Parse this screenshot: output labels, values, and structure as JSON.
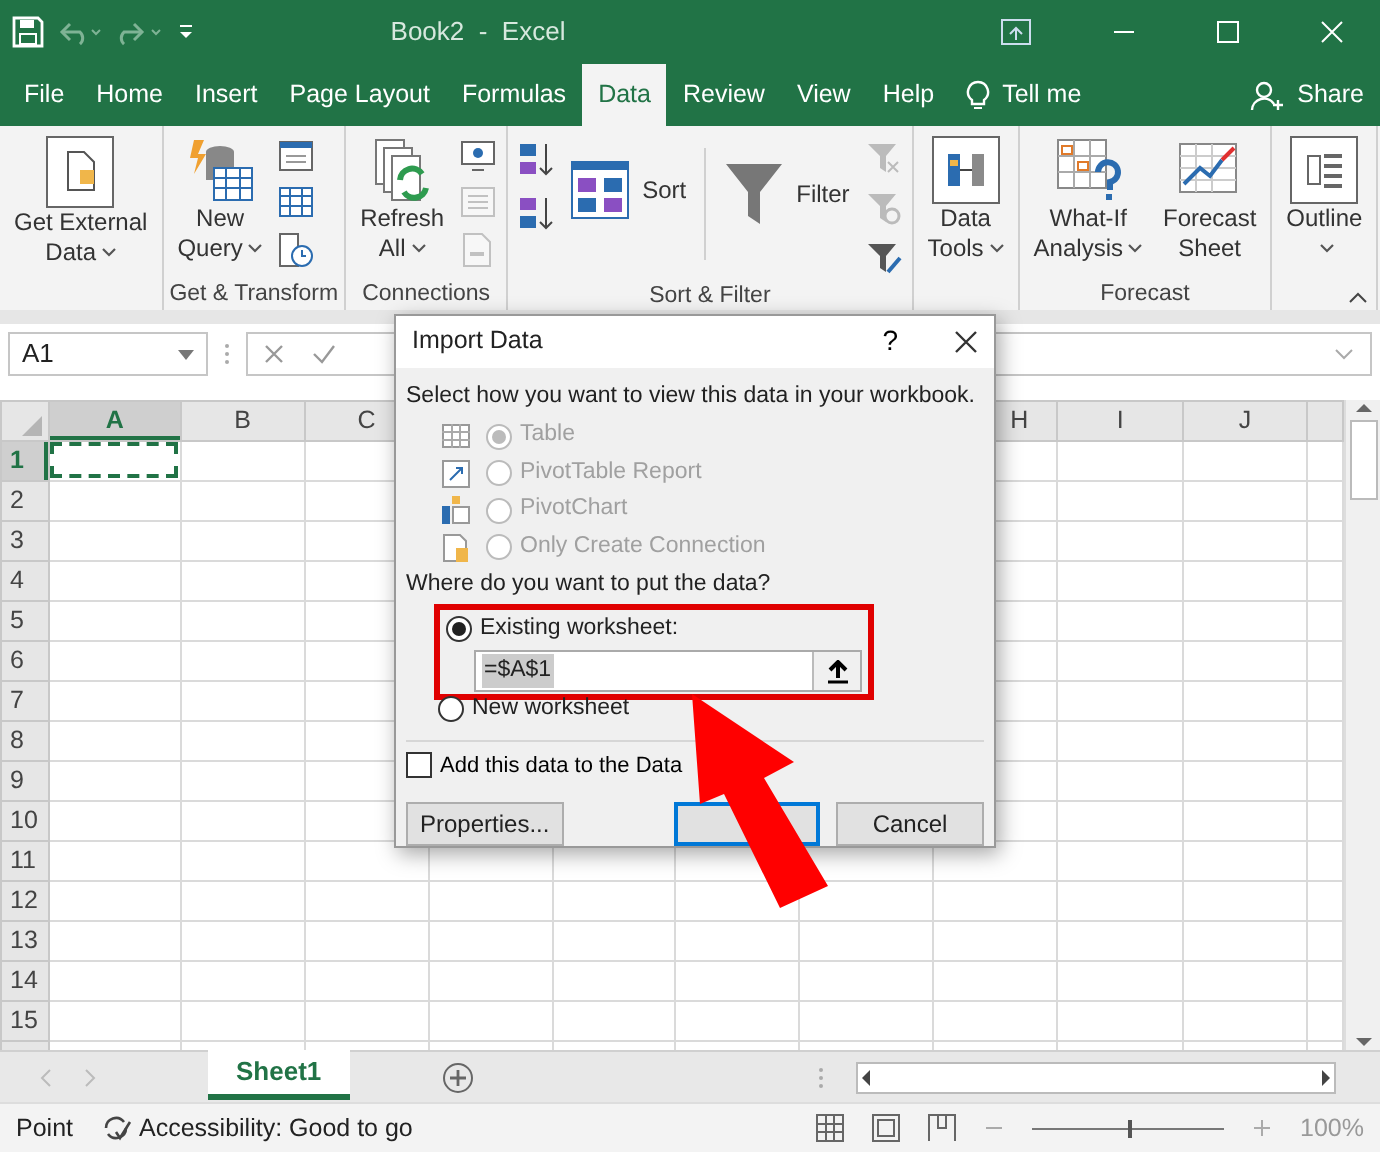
{
  "window": {
    "title": "Book2  -  Excel"
  },
  "ribbon_tabs": [
    {
      "label": "File",
      "selected": false
    },
    {
      "label": "Home",
      "selected": false
    },
    {
      "label": "Insert",
      "selected": false
    },
    {
      "label": "Page Layout",
      "selected": false
    },
    {
      "label": "Formulas",
      "selected": false
    },
    {
      "label": "Data",
      "selected": true
    },
    {
      "label": "Review",
      "selected": false
    },
    {
      "label": "View",
      "selected": false
    },
    {
      "label": "Help",
      "selected": false
    }
  ],
  "tell_me": "Tell me",
  "share": "Share",
  "ribbon_groups": [
    {
      "buttons": [
        {
          "kind": "large",
          "lines": [
            "Get External",
            "Data"
          ],
          "dropdown": true
        }
      ]
    },
    {
      "caption": "Get & Transform",
      "buttons": [
        {
          "kind": "large",
          "lines": [
            "New",
            "Query"
          ],
          "dropdown": true
        },
        {
          "kind": "small",
          "disabled": false
        },
        {
          "kind": "small",
          "disabled": false
        },
        {
          "kind": "small",
          "disabled": false
        }
      ]
    },
    {
      "caption": "Connections",
      "buttons": [
        {
          "kind": "large",
          "lines": [
            "Refresh",
            "All"
          ],
          "dropdown": true
        },
        {
          "kind": "small",
          "disabled": false
        },
        {
          "kind": "small",
          "disabled": true
        },
        {
          "kind": "small",
          "disabled": true
        }
      ]
    },
    {
      "caption": "Sort & Filter",
      "buttons": [
        {
          "kind": "small",
          "disabled": false
        },
        {
          "kind": "small",
          "disabled": false
        },
        {
          "kind": "wide",
          "lines": [
            "Sort"
          ]
        },
        {
          "kind": "separator"
        },
        {
          "kind": "wide",
          "lines": [
            "Filter"
          ]
        },
        {
          "kind": "small",
          "disabled": true
        },
        {
          "kind": "small",
          "disabled": true
        },
        {
          "kind": "small",
          "disabled": false
        }
      ]
    },
    {
      "buttons": [
        {
          "kind": "large",
          "lines": [
            "Data",
            "Tools"
          ],
          "dropdown": true
        }
      ]
    },
    {
      "caption": "Forecast",
      "buttons": [
        {
          "kind": "large",
          "lines": [
            "What-If",
            "Analysis"
          ],
          "dropdown": true
        },
        {
          "kind": "large",
          "lines": [
            "Forecast",
            "Sheet"
          ]
        }
      ]
    },
    {
      "buttons": [
        {
          "kind": "large",
          "lines": [
            "Outline"
          ],
          "dropdown": true
        }
      ]
    }
  ],
  "name_box": "A1",
  "columns_left": [
    {
      "label": "A",
      "selected": true
    },
    {
      "label": "B",
      "selected": false
    },
    {
      "label": "C",
      "selected": false
    }
  ],
  "columns_right": [
    {
      "label": "H",
      "selected": false
    },
    {
      "label": "I",
      "selected": false
    },
    {
      "label": "J",
      "selected": false
    }
  ],
  "rows": [
    {
      "label": "1",
      "selected": true
    },
    {
      "label": "2",
      "selected": false
    },
    {
      "label": "3",
      "selected": false
    },
    {
      "label": "4",
      "selected": false
    },
    {
      "label": "5",
      "selected": false
    },
    {
      "label": "6",
      "selected": false
    },
    {
      "label": "7",
      "selected": false
    },
    {
      "label": "8",
      "selected": false
    },
    {
      "label": "9",
      "selected": false
    },
    {
      "label": "10",
      "selected": false
    },
    {
      "label": "11",
      "selected": false
    },
    {
      "label": "12",
      "selected": false
    },
    {
      "label": "13",
      "selected": false
    },
    {
      "label": "14",
      "selected": false
    },
    {
      "label": "15",
      "selected": false
    }
  ],
  "sheet_tabs": [
    {
      "label": "Sheet1",
      "selected": true
    }
  ],
  "status_bar": {
    "mode": "Point",
    "accessibility": "Accessibility: Good to go",
    "zoom": "100%",
    "zoom_level": {
      "level": 0.5
    }
  },
  "dialog": {
    "title": "Import Data",
    "help": "?",
    "view_prompt": "Select how you want to view this data in your workbook.",
    "view_options": [
      {
        "label": "Table",
        "selected": true,
        "disabled": true
      },
      {
        "label": "PivotTable Report",
        "selected": false,
        "disabled": true
      },
      {
        "label": "PivotChart",
        "selected": false,
        "disabled": true
      },
      {
        "label": "Only Create Connection",
        "selected": false,
        "disabled": true
      }
    ],
    "location_prompt": "Where do you want to put the data?",
    "location_highlighted": true,
    "location_options": [
      {
        "label": "Existing worksheet:",
        "selected": true
      },
      {
        "label": "New worksheet",
        "selected": false
      }
    ],
    "reference": "=$A$1",
    "data_model": {
      "label": "Add this data to the Data",
      "checked": false
    },
    "buttons": [
      {
        "kind": "properties",
        "label": "Properties..."
      },
      {
        "kind": "ok"
      },
      {
        "kind": "cancel",
        "label": "Cancel"
      }
    ]
  },
  "annotations": [
    {
      "kind": "arrow"
    }
  ]
}
